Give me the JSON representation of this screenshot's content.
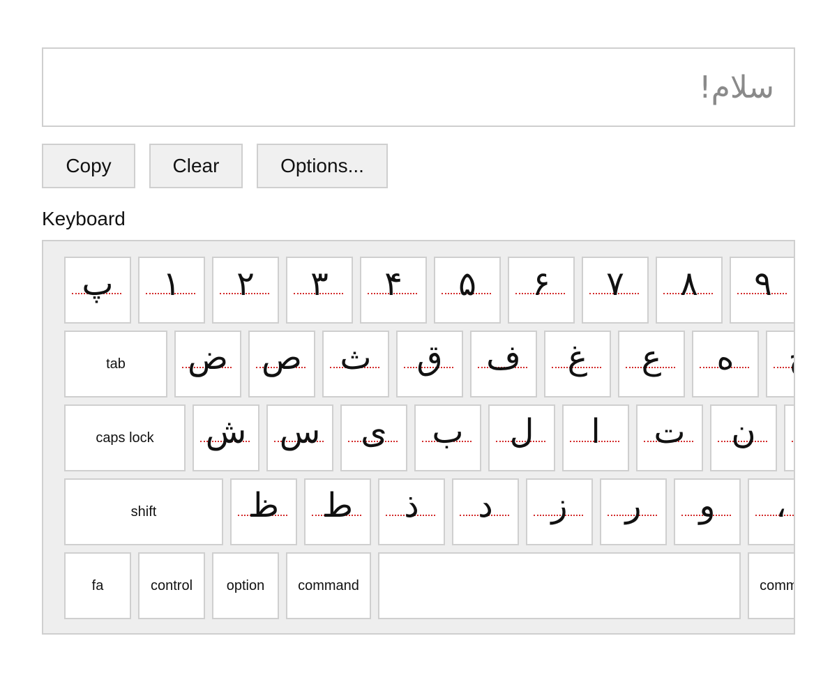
{
  "text_area": {
    "placeholder": "سلام!"
  },
  "buttons": {
    "copy": "Copy",
    "clear": "Clear",
    "options": "Options..."
  },
  "keyboard": {
    "title": "Keyboard",
    "row1": [
      "پ",
      "١",
      "٢",
      "٣",
      "۴",
      "۵",
      "۶",
      "٧",
      "٨",
      "٩"
    ],
    "row2_label": "tab",
    "row2": [
      "ض",
      "ص",
      "ث",
      "ق",
      "ف",
      "غ",
      "ع",
      "ه",
      "خ"
    ],
    "row3_label": "caps lock",
    "row3": [
      "ش",
      "س",
      "ی",
      "ب",
      "ل",
      "ا",
      "ت",
      "ن",
      "م"
    ],
    "row4_label": "shift",
    "row4": [
      "ظ",
      "ط",
      "ذ",
      "د",
      "ز",
      "ر",
      "و",
      "،"
    ],
    "row5": {
      "fa": "fa",
      "control": "control",
      "option": "option",
      "command": "command",
      "command_right": "command"
    }
  },
  "colors": {
    "underline": "#d22a2a",
    "border": "#cfcfcf",
    "keyboard_bg": "#eeeeee"
  }
}
